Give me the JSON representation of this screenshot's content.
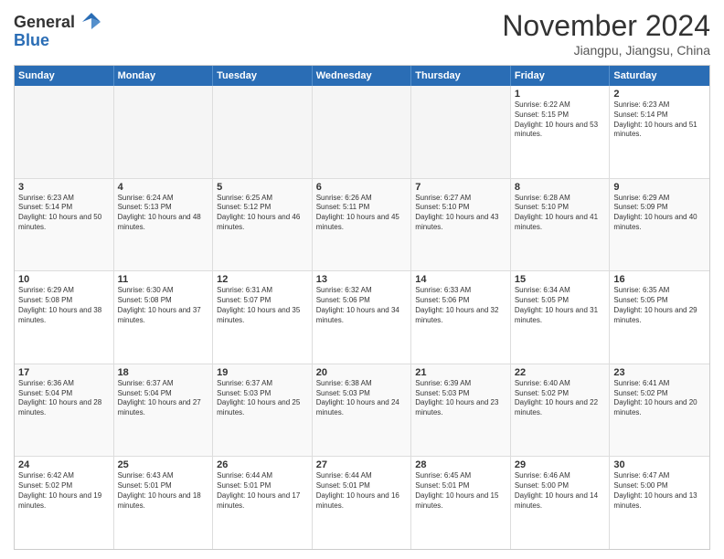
{
  "header": {
    "logo_line1": "General",
    "logo_line2": "Blue",
    "month": "November 2024",
    "location": "Jiangpu, Jiangsu, China"
  },
  "weekdays": [
    "Sunday",
    "Monday",
    "Tuesday",
    "Wednesday",
    "Thursday",
    "Friday",
    "Saturday"
  ],
  "rows": [
    {
      "cells": [
        {
          "day": "",
          "empty": true
        },
        {
          "day": "",
          "empty": true
        },
        {
          "day": "",
          "empty": true
        },
        {
          "day": "",
          "empty": true
        },
        {
          "day": "",
          "empty": true
        },
        {
          "day": "1",
          "sunrise": "6:22 AM",
          "sunset": "5:15 PM",
          "daylight": "10 hours and 53 minutes."
        },
        {
          "day": "2",
          "sunrise": "6:23 AM",
          "sunset": "5:14 PM",
          "daylight": "10 hours and 51 minutes."
        }
      ]
    },
    {
      "cells": [
        {
          "day": "3",
          "sunrise": "6:23 AM",
          "sunset": "5:14 PM",
          "daylight": "10 hours and 50 minutes."
        },
        {
          "day": "4",
          "sunrise": "6:24 AM",
          "sunset": "5:13 PM",
          "daylight": "10 hours and 48 minutes."
        },
        {
          "day": "5",
          "sunrise": "6:25 AM",
          "sunset": "5:12 PM",
          "daylight": "10 hours and 46 minutes."
        },
        {
          "day": "6",
          "sunrise": "6:26 AM",
          "sunset": "5:11 PM",
          "daylight": "10 hours and 45 minutes."
        },
        {
          "day": "7",
          "sunrise": "6:27 AM",
          "sunset": "5:10 PM",
          "daylight": "10 hours and 43 minutes."
        },
        {
          "day": "8",
          "sunrise": "6:28 AM",
          "sunset": "5:10 PM",
          "daylight": "10 hours and 41 minutes."
        },
        {
          "day": "9",
          "sunrise": "6:29 AM",
          "sunset": "5:09 PM",
          "daylight": "10 hours and 40 minutes."
        }
      ]
    },
    {
      "cells": [
        {
          "day": "10",
          "sunrise": "6:29 AM",
          "sunset": "5:08 PM",
          "daylight": "10 hours and 38 minutes."
        },
        {
          "day": "11",
          "sunrise": "6:30 AM",
          "sunset": "5:08 PM",
          "daylight": "10 hours and 37 minutes."
        },
        {
          "day": "12",
          "sunrise": "6:31 AM",
          "sunset": "5:07 PM",
          "daylight": "10 hours and 35 minutes."
        },
        {
          "day": "13",
          "sunrise": "6:32 AM",
          "sunset": "5:06 PM",
          "daylight": "10 hours and 34 minutes."
        },
        {
          "day": "14",
          "sunrise": "6:33 AM",
          "sunset": "5:06 PM",
          "daylight": "10 hours and 32 minutes."
        },
        {
          "day": "15",
          "sunrise": "6:34 AM",
          "sunset": "5:05 PM",
          "daylight": "10 hours and 31 minutes."
        },
        {
          "day": "16",
          "sunrise": "6:35 AM",
          "sunset": "5:05 PM",
          "daylight": "10 hours and 29 minutes."
        }
      ]
    },
    {
      "cells": [
        {
          "day": "17",
          "sunrise": "6:36 AM",
          "sunset": "5:04 PM",
          "daylight": "10 hours and 28 minutes."
        },
        {
          "day": "18",
          "sunrise": "6:37 AM",
          "sunset": "5:04 PM",
          "daylight": "10 hours and 27 minutes."
        },
        {
          "day": "19",
          "sunrise": "6:37 AM",
          "sunset": "5:03 PM",
          "daylight": "10 hours and 25 minutes."
        },
        {
          "day": "20",
          "sunrise": "6:38 AM",
          "sunset": "5:03 PM",
          "daylight": "10 hours and 24 minutes."
        },
        {
          "day": "21",
          "sunrise": "6:39 AM",
          "sunset": "5:03 PM",
          "daylight": "10 hours and 23 minutes."
        },
        {
          "day": "22",
          "sunrise": "6:40 AM",
          "sunset": "5:02 PM",
          "daylight": "10 hours and 22 minutes."
        },
        {
          "day": "23",
          "sunrise": "6:41 AM",
          "sunset": "5:02 PM",
          "daylight": "10 hours and 20 minutes."
        }
      ]
    },
    {
      "cells": [
        {
          "day": "24",
          "sunrise": "6:42 AM",
          "sunset": "5:02 PM",
          "daylight": "10 hours and 19 minutes."
        },
        {
          "day": "25",
          "sunrise": "6:43 AM",
          "sunset": "5:01 PM",
          "daylight": "10 hours and 18 minutes."
        },
        {
          "day": "26",
          "sunrise": "6:44 AM",
          "sunset": "5:01 PM",
          "daylight": "10 hours and 17 minutes."
        },
        {
          "day": "27",
          "sunrise": "6:44 AM",
          "sunset": "5:01 PM",
          "daylight": "10 hours and 16 minutes."
        },
        {
          "day": "28",
          "sunrise": "6:45 AM",
          "sunset": "5:01 PM",
          "daylight": "10 hours and 15 minutes."
        },
        {
          "day": "29",
          "sunrise": "6:46 AM",
          "sunset": "5:00 PM",
          "daylight": "10 hours and 14 minutes."
        },
        {
          "day": "30",
          "sunrise": "6:47 AM",
          "sunset": "5:00 PM",
          "daylight": "10 hours and 13 minutes."
        }
      ]
    }
  ]
}
